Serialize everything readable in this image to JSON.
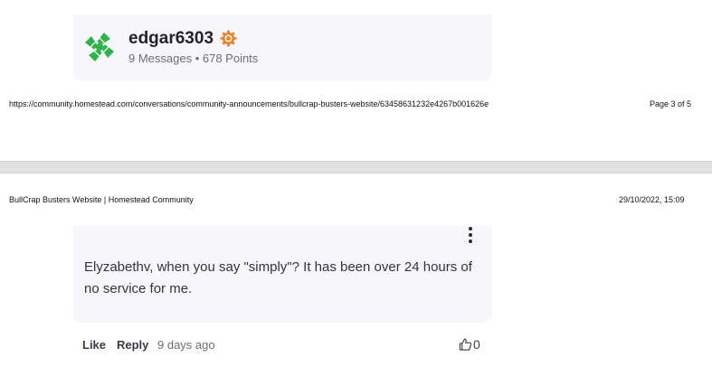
{
  "author": {
    "username": "edgar6303",
    "stats": "9 Messages • 678 Points",
    "avatar_icon": "green-pinwheel-avatar",
    "rank_icon": "orange-gear-rank-icon",
    "brand_color": "#2fb34a",
    "rank_color": "#e8852a"
  },
  "print_footer": {
    "url": "https://community.homestead.com/conversations/community-announcements/bullcrap-busters-website/63458631232e4267b001626e",
    "page": "Page 3 of 5"
  },
  "print_header": {
    "title": "BullCrap Busters Website | Homestead Community",
    "date": "29/10/2022, 15:09"
  },
  "reply": {
    "body": "Elyzabethv, when you say \"simply\"? It has been over 24 hours of no service for me.",
    "like_label": "Like",
    "reply_label": "Reply",
    "timestamp": "9 days ago",
    "like_count": "0",
    "more_icon": "vertical-ellipsis-icon",
    "thumb_icon": "thumbs-up-icon"
  }
}
